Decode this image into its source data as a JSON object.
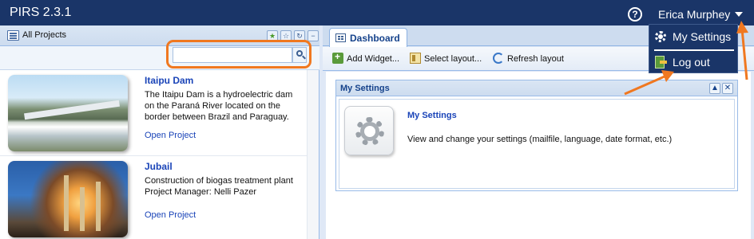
{
  "app": {
    "title": "PIRS 2.3.1",
    "help_icon": "help-icon",
    "user_name": "Erica Murphey"
  },
  "user_menu": {
    "items": [
      {
        "label": "My Settings",
        "icon": "gear-icon"
      },
      {
        "label": "Log out",
        "icon": "logout-icon"
      }
    ]
  },
  "left_panel": {
    "title": "All Projects",
    "tools": [
      "add-favorite-icon",
      "favorite-icon",
      "refresh-icon",
      "collapse-icon"
    ],
    "search": {
      "value": "",
      "placeholder": ""
    },
    "projects": [
      {
        "title": "Itaipu Dam",
        "description": "The Itaipu Dam is a hydroelectric dam on the Paraná River located on the border between Brazil and Paraguay.",
        "link": "Open Project"
      },
      {
        "title": "Jubail",
        "description": "Construction of biogas treatment plant Project Manager: Nelli Pazer",
        "link": "Open Project"
      }
    ]
  },
  "right_panel": {
    "tab": "Dashboard",
    "toolbar": {
      "add_widget": "Add Widget...",
      "select_layout": "Select layout...",
      "refresh_layout": "Refresh layout"
    },
    "portlet": {
      "title": "My Settings",
      "tools": [
        "minimize-icon",
        "close-icon"
      ],
      "item_title": "My Settings",
      "item_desc": "View and change your settings (mailfile, language, date format, etc.)"
    }
  },
  "colors": {
    "top_bar": "#1a3568",
    "annotation": "#f07820",
    "link": "#1a44b8"
  }
}
